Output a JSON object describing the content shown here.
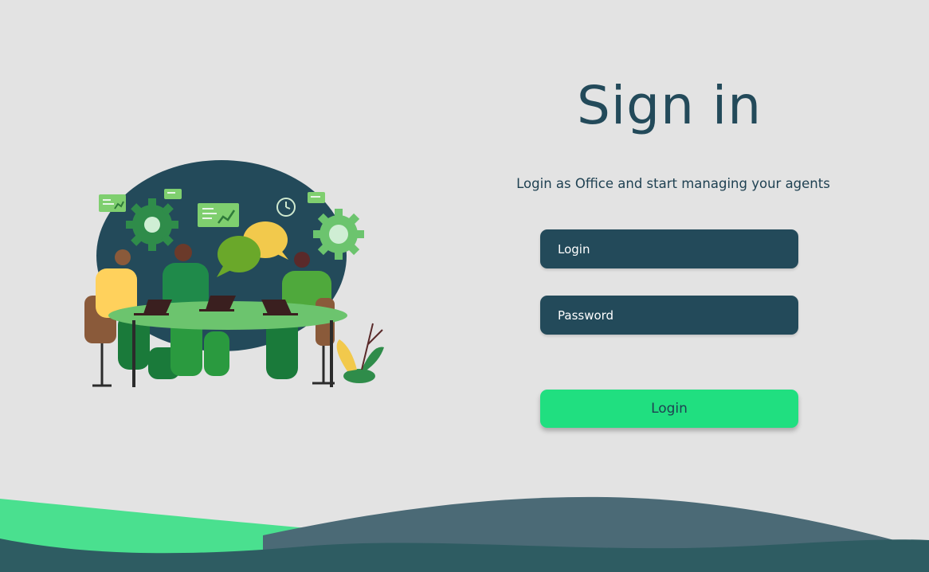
{
  "signin": {
    "title": "Sign in",
    "subtitle": "Login as Office and start managing your agents",
    "login_placeholder": "Login",
    "password_placeholder": "Password",
    "submit_label": "Login"
  },
  "colors": {
    "background": "#e3e3e3",
    "primary_dark": "#234a5a",
    "accent_green": "#20df80",
    "wave_light_green": "#4ae08f",
    "wave_slate": "#4b6a76",
    "wave_dark": "#2e5c62"
  },
  "illustration": {
    "icon": "team-meeting-illustration"
  }
}
